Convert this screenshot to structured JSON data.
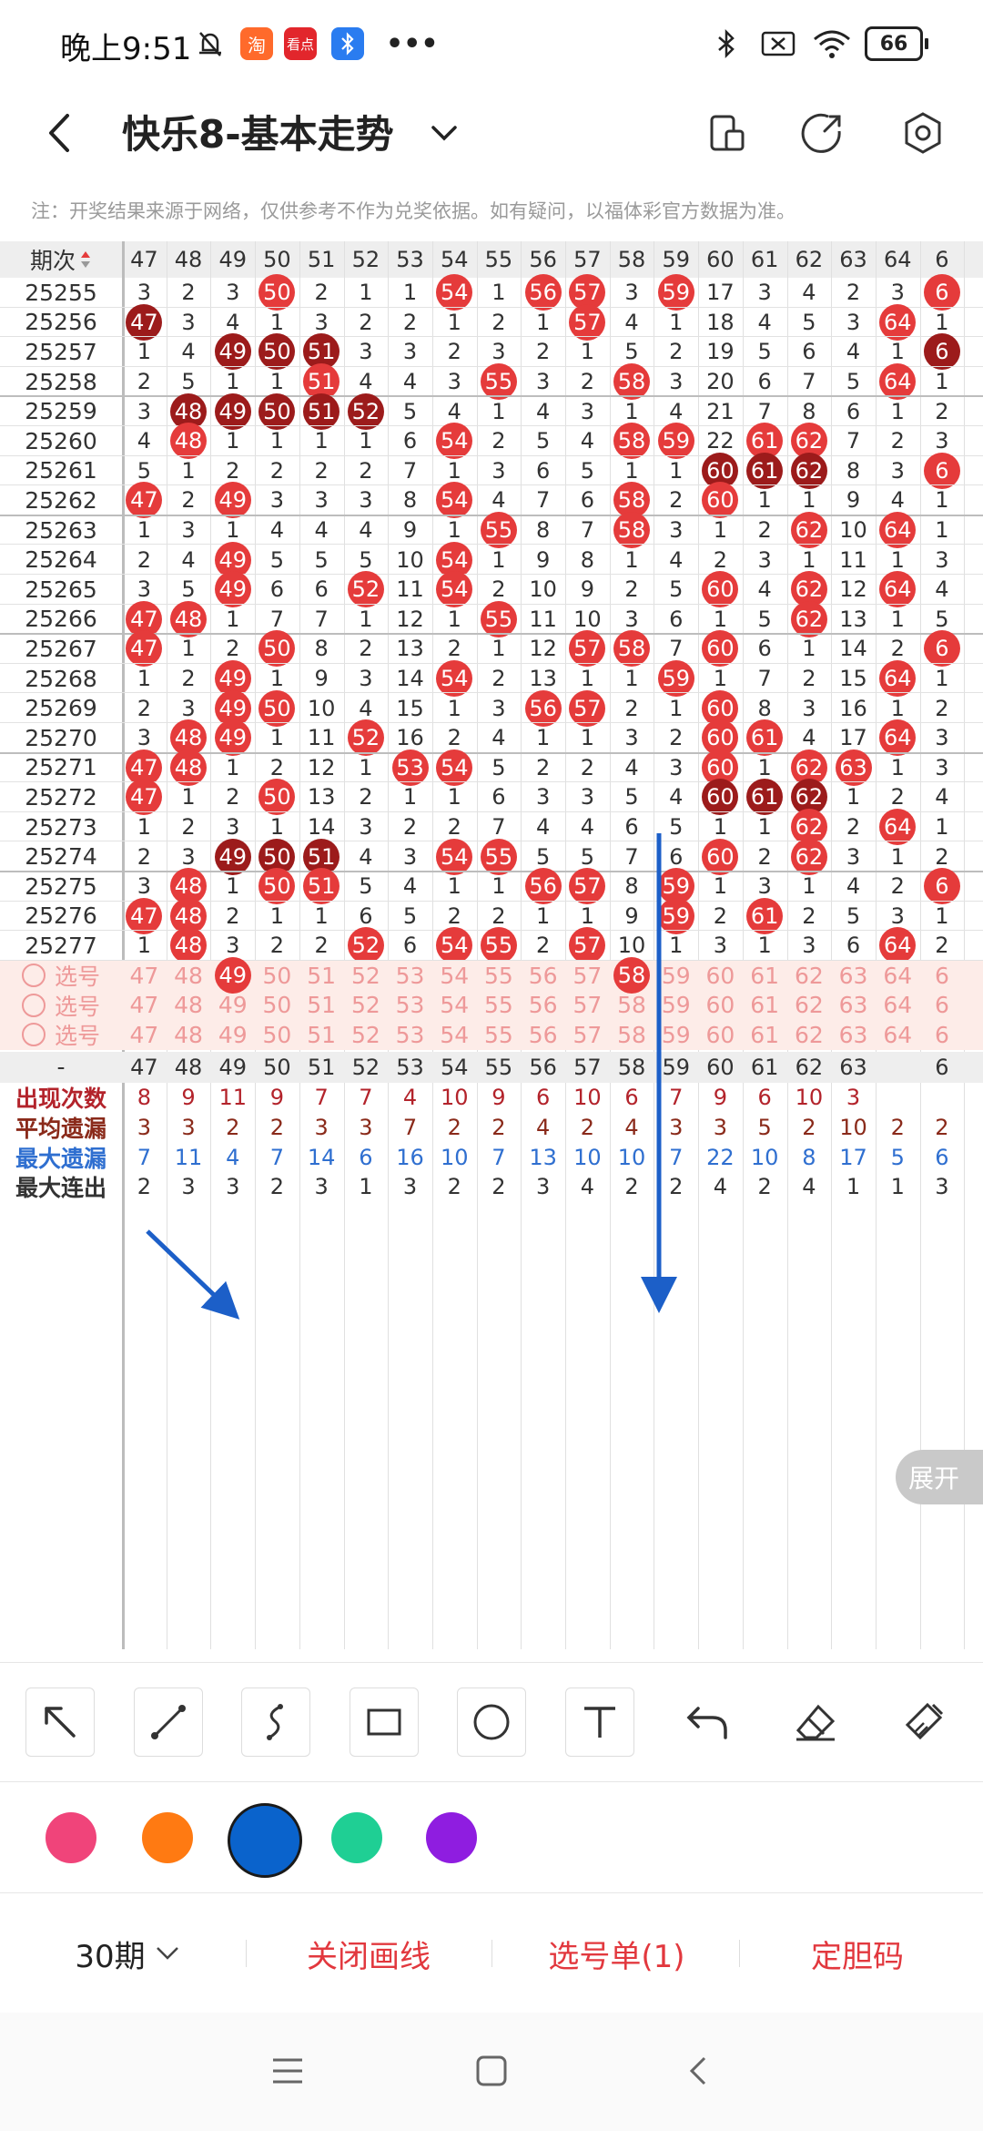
{
  "status": {
    "time": "晚上9:51",
    "app1_label": "淘",
    "app2_label": "看点",
    "battery": "66",
    "more": "•••"
  },
  "header": {
    "title": "快乐8-基本走势",
    "notice": "注：开奖结果来源于网络，仅供参考不作为兑奖依据。如有疑问，以福体彩官方数据为准。"
  },
  "table": {
    "corner_label": "期次",
    "columns": [
      "47",
      "48",
      "49",
      "50",
      "51",
      "52",
      "53",
      "54",
      "55",
      "56",
      "57",
      "58",
      "59",
      "60",
      "61",
      "62",
      "63",
      "64",
      "6"
    ],
    "rows": [
      {
        "period": "25255",
        "cells": [
          "3",
          "2",
          "3",
          "B50",
          "2",
          "1",
          "1",
          "B54",
          "1",
          "B56",
          "B57",
          "3",
          "B59",
          "17",
          "3",
          "4",
          "2",
          "3",
          "B6"
        ]
      },
      {
        "period": "25256",
        "cells": [
          "D47",
          "3",
          "4",
          "1",
          "3",
          "2",
          "2",
          "1",
          "2",
          "1",
          "B57",
          "4",
          "1",
          "18",
          "4",
          "5",
          "3",
          "B64",
          "1"
        ]
      },
      {
        "period": "25257",
        "cells": [
          "1",
          "4",
          "D49",
          "D50",
          "D51",
          "3",
          "3",
          "2",
          "3",
          "2",
          "1",
          "5",
          "2",
          "19",
          "5",
          "6",
          "4",
          "1",
          "D6"
        ]
      },
      {
        "period": "25258",
        "cells": [
          "2",
          "5",
          "1",
          "1",
          "B51",
          "4",
          "4",
          "3",
          "B55",
          "3",
          "2",
          "B58",
          "3",
          "20",
          "6",
          "7",
          "5",
          "B64",
          "1"
        ]
      },
      {
        "period": "25259",
        "cells": [
          "3",
          "D48",
          "D49",
          "D50",
          "D51",
          "D52",
          "5",
          "4",
          "1",
          "4",
          "3",
          "1",
          "4",
          "21",
          "7",
          "8",
          "6",
          "1",
          "2"
        ]
      },
      {
        "period": "25260",
        "cells": [
          "4",
          "B48",
          "1",
          "1",
          "1",
          "1",
          "6",
          "B54",
          "2",
          "5",
          "4",
          "B58",
          "B59",
          "22",
          "B61",
          "B62",
          "7",
          "2",
          "3"
        ]
      },
      {
        "period": "25261",
        "cells": [
          "5",
          "1",
          "2",
          "2",
          "2",
          "2",
          "7",
          "1",
          "3",
          "6",
          "5",
          "1",
          "1",
          "D60",
          "D61",
          "D62",
          "8",
          "3",
          "B6"
        ]
      },
      {
        "period": "25262",
        "cells": [
          "B47",
          "2",
          "B49",
          "3",
          "3",
          "3",
          "8",
          "B54",
          "4",
          "7",
          "6",
          "B58",
          "2",
          "B60",
          "1",
          "1",
          "9",
          "4",
          "1"
        ]
      },
      {
        "period": "25263",
        "cells": [
          "1",
          "3",
          "1",
          "4",
          "4",
          "4",
          "9",
          "1",
          "B55",
          "8",
          "7",
          "B58",
          "3",
          "1",
          "2",
          "B62",
          "10",
          "B64",
          "1"
        ]
      },
      {
        "period": "25264",
        "cells": [
          "2",
          "4",
          "B49",
          "5",
          "5",
          "5",
          "10",
          "B54",
          "1",
          "9",
          "8",
          "1",
          "4",
          "2",
          "3",
          "1",
          "11",
          "1",
          "3"
        ]
      },
      {
        "period": "25265",
        "cells": [
          "3",
          "5",
          "B49",
          "6",
          "6",
          "B52",
          "11",
          "B54",
          "2",
          "10",
          "9",
          "2",
          "5",
          "B60",
          "4",
          "B62",
          "12",
          "B64",
          "4"
        ]
      },
      {
        "period": "25266",
        "cells": [
          "B47",
          "B48",
          "1",
          "7",
          "7",
          "1",
          "12",
          "1",
          "B55",
          "11",
          "10",
          "3",
          "6",
          "1",
          "5",
          "B62",
          "13",
          "1",
          "5"
        ]
      },
      {
        "period": "25267",
        "cells": [
          "B47",
          "1",
          "2",
          "B50",
          "8",
          "2",
          "13",
          "2",
          "1",
          "12",
          "B57",
          "B58",
          "7",
          "B60",
          "6",
          "1",
          "14",
          "2",
          "B6"
        ]
      },
      {
        "period": "25268",
        "cells": [
          "1",
          "2",
          "B49",
          "1",
          "9",
          "3",
          "14",
          "B54",
          "2",
          "13",
          "1",
          "1",
          "B59",
          "1",
          "7",
          "2",
          "15",
          "B64",
          "1"
        ]
      },
      {
        "period": "25269",
        "cells": [
          "2",
          "3",
          "B49",
          "B50",
          "10",
          "4",
          "15",
          "1",
          "3",
          "B56",
          "B57",
          "2",
          "1",
          "B60",
          "8",
          "3",
          "16",
          "1",
          "2"
        ]
      },
      {
        "period": "25270",
        "cells": [
          "3",
          "B48",
          "B49",
          "1",
          "11",
          "B52",
          "16",
          "2",
          "4",
          "1",
          "1",
          "3",
          "2",
          "B60",
          "B61",
          "4",
          "17",
          "B64",
          "3"
        ]
      },
      {
        "period": "25271",
        "cells": [
          "B47",
          "B48",
          "1",
          "2",
          "12",
          "1",
          "B53",
          "B54",
          "5",
          "2",
          "2",
          "4",
          "3",
          "B60",
          "1",
          "B62",
          "B63",
          "1",
          "3"
        ]
      },
      {
        "period": "25272",
        "cells": [
          "B47",
          "1",
          "2",
          "B50",
          "13",
          "2",
          "1",
          "1",
          "6",
          "3",
          "3",
          "5",
          "4",
          "D60",
          "D61",
          "D62",
          "1",
          "2",
          "4"
        ]
      },
      {
        "period": "25273",
        "cells": [
          "1",
          "2",
          "3",
          "1",
          "14",
          "3",
          "2",
          "2",
          "7",
          "4",
          "4",
          "6",
          "5",
          "1",
          "1",
          "B62",
          "2",
          "B64",
          "1"
        ]
      },
      {
        "period": "25274",
        "cells": [
          "2",
          "3",
          "D49",
          "D50",
          "D51",
          "4",
          "3",
          "B54",
          "B55",
          "5",
          "5",
          "7",
          "6",
          "B60",
          "2",
          "B62",
          "3",
          "1",
          "2"
        ]
      },
      {
        "period": "25275",
        "cells": [
          "3",
          "B48",
          "1",
          "B50",
          "B51",
          "5",
          "4",
          "1",
          "1",
          "B56",
          "B57",
          "8",
          "B59",
          "1",
          "3",
          "1",
          "4",
          "2",
          "B6"
        ]
      },
      {
        "period": "25276",
        "cells": [
          "B47",
          "B48",
          "2",
          "1",
          "1",
          "6",
          "5",
          "2",
          "2",
          "1",
          "1",
          "9",
          "B59",
          "2",
          "B61",
          "2",
          "5",
          "3",
          "1"
        ]
      },
      {
        "period": "25277",
        "cells": [
          "1",
          "B48",
          "3",
          "2",
          "2",
          "B52",
          "6",
          "B54",
          "B55",
          "2",
          "B57",
          "10",
          "1",
          "3",
          "1",
          "3",
          "6",
          "B64",
          "2"
        ]
      }
    ],
    "pick_label": "选号",
    "pick_rows": [
      {
        "cells": [
          "47",
          "48",
          "B49",
          "50",
          "51",
          "52",
          "53",
          "54",
          "55",
          "56",
          "57",
          "B58",
          "59",
          "60",
          "61",
          "62",
          "63",
          "64",
          "6"
        ]
      },
      {
        "cells": [
          "47",
          "48",
          "49",
          "50",
          "51",
          "52",
          "53",
          "54",
          "55",
          "56",
          "57",
          "58",
          "59",
          "60",
          "61",
          "62",
          "63",
          "64",
          "6"
        ]
      },
      {
        "cells": [
          "47",
          "48",
          "49",
          "50",
          "51",
          "52",
          "53",
          "54",
          "55",
          "56",
          "57",
          "58",
          "59",
          "60",
          "61",
          "62",
          "63",
          "64",
          "6"
        ]
      }
    ],
    "footer_header": {
      "label": "-",
      "cells": [
        "47",
        "48",
        "49",
        "50",
        "51",
        "52",
        "53",
        "54",
        "55",
        "56",
        "57",
        "58",
        "59",
        "60",
        "61",
        "62",
        "63",
        "",
        "6"
      ]
    },
    "stats": [
      {
        "label": "出现次数",
        "color": "#b3232b",
        "cells": [
          "8",
          "9",
          "11",
          "9",
          "7",
          "7",
          "4",
          "10",
          "9",
          "6",
          "10",
          "6",
          "7",
          "9",
          "6",
          "10",
          "3",
          "",
          ""
        ]
      },
      {
        "label": "平均遗漏",
        "color": "#8a2a1a",
        "cells": [
          "3",
          "3",
          "2",
          "2",
          "3",
          "3",
          "7",
          "2",
          "2",
          "4",
          "2",
          "4",
          "3",
          "3",
          "5",
          "2",
          "10",
          "2",
          "2"
        ]
      },
      {
        "label": "最大遗漏",
        "color": "#2f6fd0",
        "cells": [
          "7",
          "11",
          "4",
          "7",
          "14",
          "6",
          "16",
          "10",
          "7",
          "13",
          "10",
          "10",
          "7",
          "22",
          "10",
          "8",
          "17",
          "5",
          "6"
        ]
      },
      {
        "label": "最大连出",
        "color": "#333333",
        "cells": [
          "2",
          "3",
          "3",
          "2",
          "3",
          "1",
          "3",
          "2",
          "2",
          "3",
          "4",
          "2",
          "2",
          "4",
          "2",
          "4",
          "1",
          "1",
          "3"
        ]
      }
    ],
    "expand_label": "展开"
  },
  "colors": {
    "swatches": [
      "#f0447a",
      "#ff7a12",
      "#0a63cc",
      "#1fcf94",
      "#8f1de0"
    ],
    "selected": 2,
    "ball_red": "#e53b3b",
    "ball_dark": "#9c1b1b",
    "line_blue": "#1c5fc8"
  },
  "bottom": {
    "period_select": "30期",
    "close_lines": "关闭画线",
    "pick_list": "选号单(1)",
    "fix_code": "定胆码"
  },
  "icons": [
    "back-icon",
    "dropdown-chevron-icon",
    "phone-layout-icon",
    "share-icon",
    "settings-hex-icon",
    "arrow-tool-icon",
    "line-tool-icon",
    "curve-tool-icon",
    "rect-tool-icon",
    "circle-tool-icon",
    "text-tool-icon",
    "undo-icon",
    "eraser-icon",
    "clear-icon"
  ]
}
